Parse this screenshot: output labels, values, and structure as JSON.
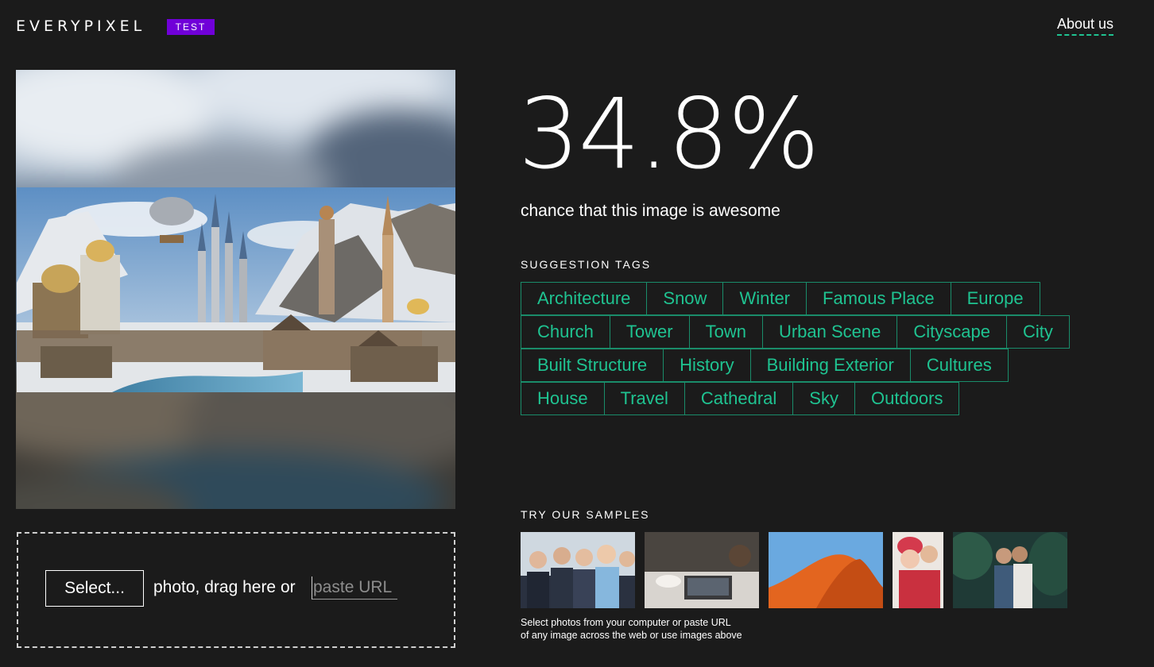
{
  "header": {
    "logo_text": "EVERYPIXEL",
    "badge": "TEST",
    "about_link": "About us"
  },
  "result": {
    "score": "34.8%",
    "caption": "chance that this image is awesome"
  },
  "tags_section": {
    "label": "SUGGESTION TAGS",
    "rows": [
      [
        "Architecture",
        "Snow",
        "Winter",
        "Famous Place",
        "Europe"
      ],
      [
        "Church",
        "Tower",
        "Town",
        "Urban Scene",
        "Cityscape",
        "City"
      ],
      [
        "Built Structure",
        "History",
        "Building Exterior",
        "Cultures"
      ],
      [
        "House",
        "Travel",
        "Cathedral",
        "Sky",
        "Outdoors"
      ]
    ]
  },
  "upload": {
    "select_label": "Select...",
    "instructions": "photo, drag here or",
    "url_placeholder": "paste URL"
  },
  "samples_section": {
    "label": "TRY OUR SAMPLES",
    "note_line1": "Select photos from your computer or paste URL",
    "note_line2": "of any image across the web or use images above"
  },
  "colors": {
    "background": "#1b1b1b",
    "accent_tag": "#1fc391",
    "badge": "#7000d8"
  }
}
